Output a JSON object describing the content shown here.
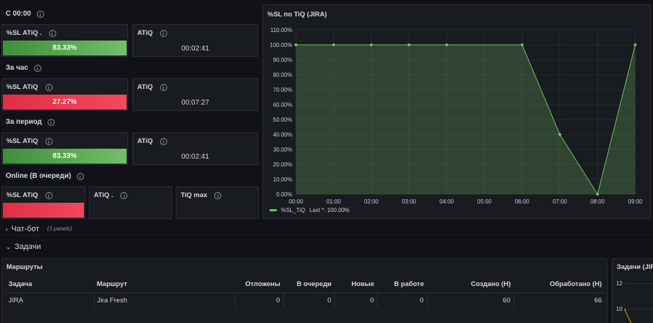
{
  "stats": {
    "group1": {
      "label": "С 00:00",
      "sl_title": "%SL ATiQ .",
      "sl_value": "83.33%",
      "sl_fraction": 0.8333,
      "atiq_title": "ATiQ",
      "atiq_value": "00:02:41"
    },
    "group2": {
      "label": "За час",
      "sl_title": "%SL ATiQ",
      "sl_value": "27.27%",
      "sl_fraction": 0.2727,
      "atiq_title": "ATiQ",
      "atiq_value": "00:07:27"
    },
    "group3": {
      "label": "За период",
      "sl_title": "%SL ATiQ",
      "sl_value": "83.33%",
      "sl_fraction": 0.8333,
      "atiq_title": "ATiQ",
      "atiq_value": "00:02:41"
    },
    "group4": {
      "label": "Online (В очереди)",
      "sl_title": "%SL ATiQ",
      "atiq_title": "ATiQ .",
      "tiqmax_title": "TiQ max"
    }
  },
  "chart_panel": {
    "title": "%SL по TiQ (JIRA)",
    "legend_label": "%SL_TiQ",
    "legend_last": "Last *: 100.00%"
  },
  "chart_data": {
    "type": "area",
    "title": "%SL по TiQ (JIRA)",
    "x": [
      "00:00",
      "01:00",
      "02:00",
      "03:00",
      "04:00",
      "05:00",
      "06:00",
      "07:00",
      "08:00",
      "09:00"
    ],
    "series": [
      {
        "name": "%SL_TiQ",
        "values": [
          100,
          100,
          100,
          100,
          100,
          null,
          100,
          40,
          0,
          100
        ]
      }
    ],
    "points": [
      [
        0,
        100
      ],
      [
        1,
        100
      ],
      [
        2,
        100
      ],
      [
        3,
        100
      ],
      [
        4,
        100
      ],
      [
        6,
        100
      ],
      [
        7,
        40
      ],
      [
        8,
        0
      ],
      [
        9,
        100
      ]
    ],
    "yticks": [
      "0.00%",
      "10.00%",
      "20.00%",
      "30.00%",
      "40.00%",
      "50.00%",
      "60.00%",
      "70.00%",
      "80.00%",
      "90.00%",
      "100.00%",
      "110.00%"
    ],
    "ylim": [
      0,
      110
    ],
    "grid": true,
    "legend": "bottom-left",
    "color": "#73bf69"
  },
  "rows": {
    "chatbot": {
      "title": "Чат-бот",
      "sub": "(3 panels)"
    },
    "tasks": {
      "title": "Задачи"
    }
  },
  "routes": {
    "title": "Маршруты",
    "columns": [
      "Задача",
      "Маршрут",
      "Отложены",
      "В очереди",
      "Новые",
      "В работе",
      "Создано (Н)",
      "Обработано (Н)"
    ],
    "rows": [
      [
        "JIRA",
        "Jira Fresh",
        "0",
        "0",
        "0",
        "0",
        "60",
        "66"
      ]
    ]
  },
  "right_panel": {
    "title": "Задачи (JIR",
    "y_labels": [
      "12",
      "10"
    ]
  },
  "colors": {
    "background": "#111217",
    "panel": "#181b1f",
    "green": "#73bf69",
    "red": "#f2495c",
    "border": "#2c2f35"
  }
}
